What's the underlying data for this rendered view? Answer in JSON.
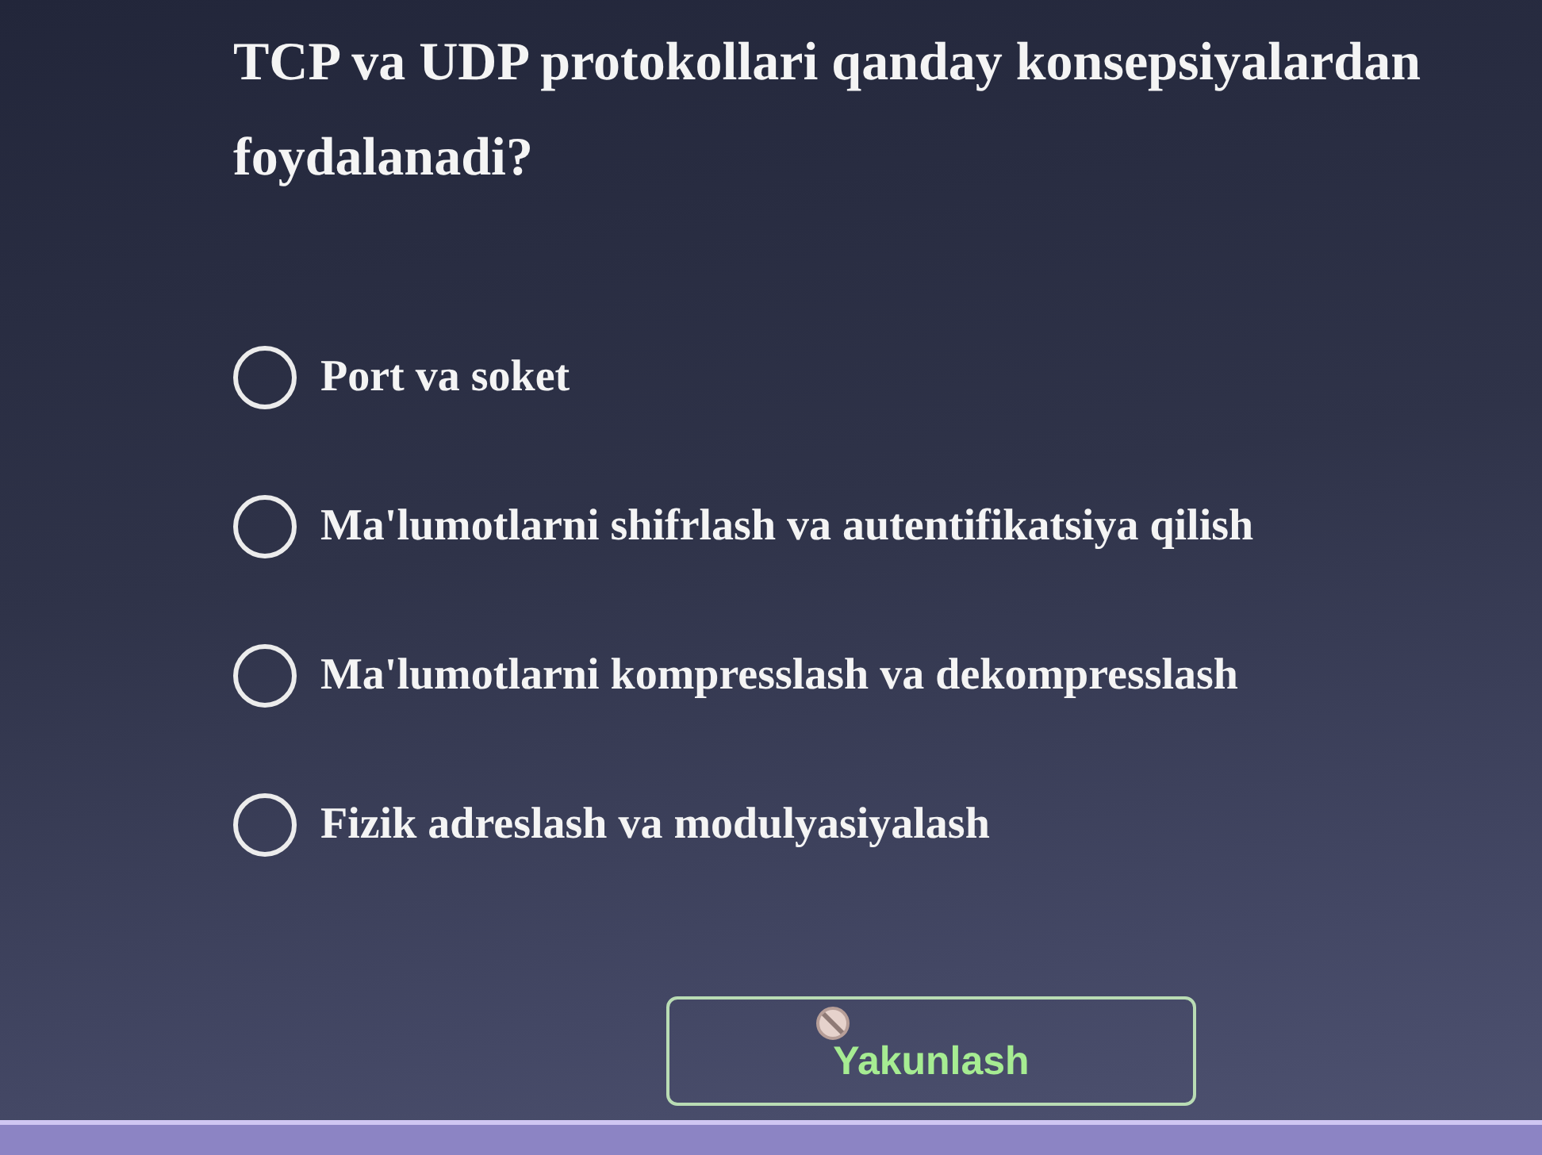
{
  "question": "TCP va UDP protokollari qanday konsepsiyalardan foydalanadi?",
  "options": [
    {
      "label": "Port va soket",
      "selected": false
    },
    {
      "label": "Ma'lumotlarni shifrlash va autentifikatsiya qilish",
      "selected": false
    },
    {
      "label": "Ma'lumotlarni kompresslash va dekompresslash",
      "selected": false
    },
    {
      "label": "Fizik adreslash va modulyasiyalash",
      "selected": false
    }
  ],
  "finish_button": {
    "label": "Yakunlash",
    "disabled": true
  }
}
